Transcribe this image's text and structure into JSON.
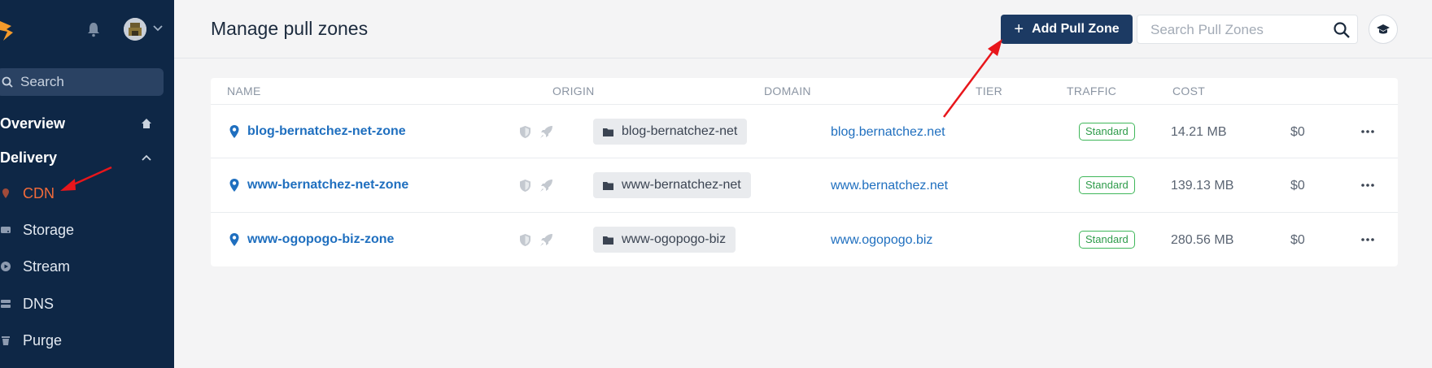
{
  "sidebar": {
    "search_placeholder": "Search",
    "overview_label": "Overview",
    "delivery_label": "Delivery",
    "items": [
      {
        "label": "CDN",
        "icon": "map-pin-icon",
        "active": true
      },
      {
        "label": "Storage",
        "icon": "storage-icon",
        "active": false
      },
      {
        "label": "Stream",
        "icon": "play-icon",
        "active": false
      },
      {
        "label": "DNS",
        "icon": "dns-icon",
        "active": false
      },
      {
        "label": "Purge",
        "icon": "trash-icon",
        "active": false
      }
    ]
  },
  "header": {
    "title": "Manage pull zones",
    "add_button_label": "Add Pull Zone",
    "search_placeholder": "Search Pull Zones"
  },
  "table": {
    "columns": [
      "NAME",
      "ORIGIN",
      "DOMAIN",
      "TIER",
      "TRAFFIC",
      "COST"
    ],
    "rows": [
      {
        "name": "blog-bernatchez-net-zone",
        "origin": "blog-bernatchez-net",
        "domain": "blog.bernatchez.net",
        "tier": "Standard",
        "traffic": "14.21 MB",
        "cost": "$0"
      },
      {
        "name": "www-bernatchez-net-zone",
        "origin": "www-bernatchez-net",
        "domain": "www.bernatchez.net",
        "tier": "Standard",
        "traffic": "139.13 MB",
        "cost": "$0"
      },
      {
        "name": "www-ogopogo-biz-zone",
        "origin": "www-ogopogo-biz",
        "domain": "www.ogopogo.biz",
        "tier": "Standard",
        "traffic": "280.56 MB",
        "cost": "$0"
      }
    ]
  },
  "colors": {
    "sidebar_bg": "#0e2746",
    "accent_active": "#f26b3a",
    "primary_button": "#1c3a63",
    "link": "#1f6fbf",
    "tier_green": "#3fb75a",
    "annotation_arrow": "#e8161b"
  }
}
